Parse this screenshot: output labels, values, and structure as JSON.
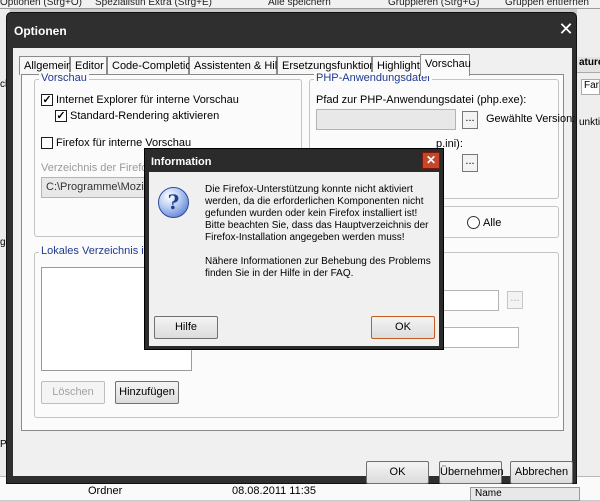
{
  "background": {
    "top_fragments": [
      "Optionen (Strg+O)",
      "Spezialistin Extra (Strg+E)",
      "Alle speichern",
      "Gruppieren (Strg+G)",
      "Gruppen entfernen"
    ],
    "left_fragments": [
      "ck",
      "g",
      "Pr"
    ],
    "right_header": "aturen",
    "right_field": "Far",
    "right_text": "unktion",
    "bottom_row": {
      "type": "Ordner",
      "date": "08.08.2011 11:35",
      "column": "Name"
    }
  },
  "options_dialog": {
    "title": "Optionen",
    "close_glyph": "✕",
    "tabs": [
      "Allgemein",
      "Editor",
      "Code-Completion",
      "Assistenten & Hilfen",
      "Ersetzungsfunktionen",
      "Highlighter",
      "Vorschau"
    ],
    "active_tab": "Vorschau",
    "preview_group": {
      "legend": "Vorschau",
      "ie_preview": {
        "label": "Internet Explorer für interne Vorschau",
        "checked": true
      },
      "standard_rendering": {
        "label": "Standard-Rendering aktivieren",
        "checked": true
      },
      "firefox_preview": {
        "label": "Firefox für interne Vorschau",
        "checked": false
      },
      "firefox_dir_label": "Verzeichnis der Firefox-Installation",
      "firefox_dir_value": "C:\\Programme\\Mozilla Firefox"
    },
    "php_group": {
      "legend": "PHP-Anwendungsdatei",
      "path_label": "Pfad zur PHP-Anwendungsdatei (php.exe):",
      "browse_glyph": "...",
      "selected_version_label": "Gewählte Version:",
      "ini_label_fragment": "p.ini):",
      "ini_browse_glyph": "..."
    },
    "radio_all_label": "Alle",
    "local_dir_group": {
      "legend": "Lokales Verzeichnis in URL",
      "delete_button": "Löschen",
      "add_button": "Hinzufügen",
      "browse_glyph": "..."
    },
    "buttons": {
      "ok": "OK",
      "apply": "Übernehmen",
      "cancel": "Abbrechen"
    }
  },
  "info_dialog": {
    "title": "Information",
    "close_glyph": "✕",
    "icon_glyph": "?",
    "message": "Die Firefox-Unterstützung konnte nicht aktiviert werden, da die erforderlichen Komponenten nicht gefunden wurden oder kein Firefox installiert ist!\nBitte beachten Sie, dass das Hauptverzeichnis der Firefox-Installation angegeben werden muss!\n\nNähere Informationen zur Behebung des Problems finden Sie in der Hilfe in der FAQ.",
    "help_button": "Hilfe",
    "ok_button": "OK"
  },
  "colors": {
    "title_bar": "#2f2f2f",
    "group_legend": "#1f3a92",
    "close_red": "#c7462a",
    "focus_border": "#c45c1e"
  }
}
